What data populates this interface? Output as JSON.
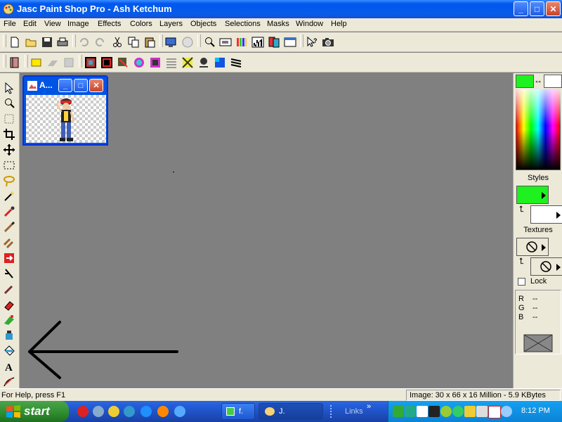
{
  "window": {
    "title": "Jasc Paint Shop Pro - Ash Ketchum",
    "minimize": "_",
    "maximize": "□",
    "close": "✕"
  },
  "menu": [
    "File",
    "Edit",
    "View",
    "Image",
    "Effects",
    "Colors",
    "Layers",
    "Objects",
    "Selections",
    "Masks",
    "Window",
    "Help"
  ],
  "child_window": {
    "title": "A...",
    "minimize": "_",
    "maximize": "□",
    "close": "✕"
  },
  "palette": {
    "styles_label": "Styles",
    "textures_label": "Textures",
    "lock_label": "Lock",
    "rgb": [
      {
        "channel": "R",
        "value": "--"
      },
      {
        "channel": "G",
        "value": "--"
      },
      {
        "channel": "B",
        "value": "--"
      }
    ],
    "foreground_color": "#1ff01f",
    "background_color": "#ffffff"
  },
  "status": {
    "help_text": "For Help, press F1",
    "image_info": "Image:  30 x 66 x 16 Million - 5.9 KBytes"
  },
  "taskbar": {
    "start_label": "start",
    "tasks": [
      {
        "label": "f."
      },
      {
        "label": "J."
      }
    ],
    "links_label": "Links",
    "links_more": "»",
    "clock": "8:12 PM"
  }
}
